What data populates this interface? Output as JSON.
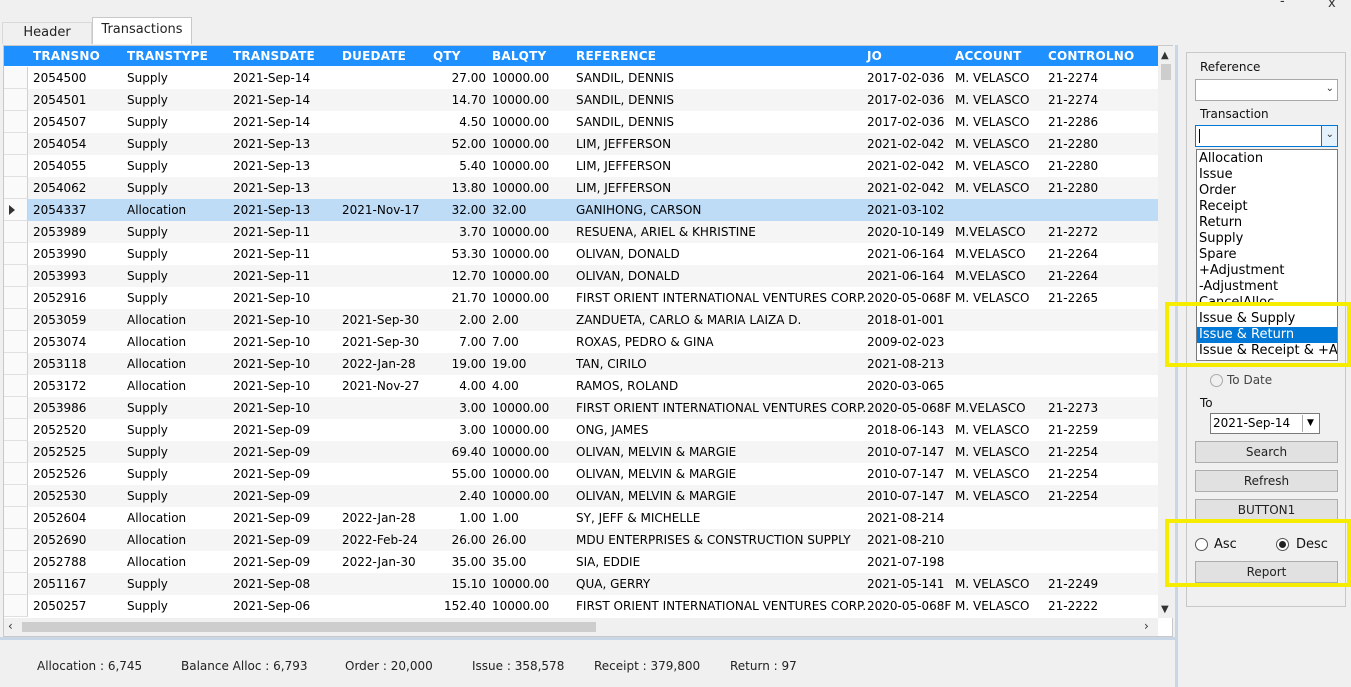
{
  "window": {
    "minimize": "-",
    "close": "x"
  },
  "tabs": [
    {
      "label": "Header"
    },
    {
      "label": "Transactions"
    }
  ],
  "grid": {
    "columns": [
      "TRANSNO",
      "TRANSTYPE",
      "TRANSDATE",
      "DUEDATE",
      "QTY",
      "BALQTY",
      "REFERENCE",
      "JO",
      "ACCOUNT",
      "CONTROLNO"
    ],
    "rows": [
      [
        "2054500",
        "Supply",
        "2021-Sep-14",
        "",
        "27.00",
        "10000.00",
        "SANDIL, DENNIS",
        "2017-02-036",
        "M. VELASCO",
        "21-2274"
      ],
      [
        "2054501",
        "Supply",
        "2021-Sep-14",
        "",
        "14.70",
        "10000.00",
        "SANDIL, DENNIS",
        "2017-02-036",
        "M. VELASCO",
        "21-2274"
      ],
      [
        "2054507",
        "Supply",
        "2021-Sep-14",
        "",
        "4.50",
        "10000.00",
        "SANDIL, DENNIS",
        "2017-02-036",
        "M. VELASCO",
        "21-2286"
      ],
      [
        "2054054",
        "Supply",
        "2021-Sep-13",
        "",
        "52.00",
        "10000.00",
        "LIM, JEFFERSON",
        "2021-02-042",
        "M. VELASCO",
        "21-2280"
      ],
      [
        "2054055",
        "Supply",
        "2021-Sep-13",
        "",
        "5.40",
        "10000.00",
        "LIM, JEFFERSON",
        "2021-02-042",
        "M. VELASCO",
        "21-2280"
      ],
      [
        "2054062",
        "Supply",
        "2021-Sep-13",
        "",
        "13.80",
        "10000.00",
        "LIM, JEFFERSON",
        "2021-02-042",
        "M. VELASCO",
        "21-2280"
      ],
      [
        "2054337",
        "Allocation",
        "2021-Sep-13",
        "2021-Nov-17",
        "32.00",
        "32.00",
        "GANIHONG, CARSON",
        "2021-03-102",
        "",
        ""
      ],
      [
        "2053989",
        "Supply",
        "2021-Sep-11",
        "",
        "3.70",
        "10000.00",
        "RESUENA, ARIEL & KHRISTINE",
        "2020-10-149",
        "M.VELASCO",
        "21-2272"
      ],
      [
        "2053990",
        "Supply",
        "2021-Sep-11",
        "",
        "53.30",
        "10000.00",
        "OLIVAN, DONALD",
        "2021-06-164",
        "M.VELASCO",
        "21-2264"
      ],
      [
        "2053993",
        "Supply",
        "2021-Sep-11",
        "",
        "12.70",
        "10000.00",
        "OLIVAN, DONALD",
        "2021-06-164",
        "M.VELASCO",
        "21-2264"
      ],
      [
        "2052916",
        "Supply",
        "2021-Sep-10",
        "",
        "21.70",
        "10000.00",
        "FIRST ORIENT INTERNATIONAL VENTURES CORP.",
        "2020-05-068F",
        "M. VELASCO",
        "21-2265"
      ],
      [
        "2053059",
        "Allocation",
        "2021-Sep-10",
        "2021-Sep-30",
        "2.00",
        "2.00",
        "ZANDUETA, CARLO & MARIA LAIZA D.",
        "2018-01-001",
        "",
        ""
      ],
      [
        "2053074",
        "Allocation",
        "2021-Sep-10",
        "2021-Sep-30",
        "7.00",
        "7.00",
        "ROXAS, PEDRO & GINA",
        "2009-02-023",
        "",
        ""
      ],
      [
        "2053118",
        "Allocation",
        "2021-Sep-10",
        "2022-Jan-28",
        "19.00",
        "19.00",
        "TAN, CIRILO",
        "2021-08-213",
        "",
        ""
      ],
      [
        "2053172",
        "Allocation",
        "2021-Sep-10",
        "2021-Nov-27",
        "4.00",
        "4.00",
        "RAMOS, ROLAND",
        "2020-03-065",
        "",
        ""
      ],
      [
        "2053986",
        "Supply",
        "2021-Sep-10",
        "",
        "3.00",
        "10000.00",
        "FIRST ORIENT INTERNATIONAL VENTURES CORP.",
        "2020-05-068F",
        "M.VELASCO",
        "21-2273"
      ],
      [
        "2052520",
        "Supply",
        "2021-Sep-09",
        "",
        "3.00",
        "10000.00",
        "ONG, JAMES",
        "2018-06-143",
        "M. VELASCO",
        "21-2259"
      ],
      [
        "2052525",
        "Supply",
        "2021-Sep-09",
        "",
        "69.40",
        "10000.00",
        "OLIVAN, MELVIN & MARGIE",
        "2010-07-147",
        "M. VELASCO",
        "21-2254"
      ],
      [
        "2052526",
        "Supply",
        "2021-Sep-09",
        "",
        "55.00",
        "10000.00",
        "OLIVAN, MELVIN & MARGIE",
        "2010-07-147",
        "M. VELASCO",
        "21-2254"
      ],
      [
        "2052530",
        "Supply",
        "2021-Sep-09",
        "",
        "2.40",
        "10000.00",
        "OLIVAN, MELVIN & MARGIE",
        "2010-07-147",
        "M. VELASCO",
        "21-2254"
      ],
      [
        "2052604",
        "Allocation",
        "2021-Sep-09",
        "2022-Jan-28",
        "1.00",
        "1.00",
        "SY, JEFF & MICHELLE",
        "2021-08-214",
        "",
        ""
      ],
      [
        "2052690",
        "Allocation",
        "2021-Sep-09",
        "2022-Feb-24",
        "26.00",
        "26.00",
        "MDU ENTERPRISES & CONSTRUCTION SUPPLY",
        "2021-08-210",
        "",
        ""
      ],
      [
        "2052788",
        "Allocation",
        "2021-Sep-09",
        "2022-Jan-30",
        "35.00",
        "35.00",
        "SIA, EDDIE",
        "2021-07-198",
        "",
        ""
      ],
      [
        "2051167",
        "Supply",
        "2021-Sep-08",
        "",
        "15.10",
        "10000.00",
        "QUA, GERRY",
        "2021-05-141",
        "M. VELASCO",
        "21-2249"
      ],
      [
        "2050257",
        "Supply",
        "2021-Sep-06",
        "",
        "152.40",
        "10000.00",
        "FIRST ORIENT INTERNATIONAL VENTURES CORP.",
        "2020-05-068F",
        "M. VELASCO",
        "21-2222"
      ]
    ],
    "selected_row_index": 6
  },
  "status": {
    "allocation": "Allocation :  6,745",
    "balance_alloc": "Balance Alloc :  6,793",
    "order": "Order :  20,000",
    "issue": "Issue :  358,578",
    "receipt": "Receipt :  379,800",
    "return": "Return :  97"
  },
  "panel": {
    "reference_label": "Reference",
    "reference_value": "",
    "transaction_label": "Transaction",
    "transaction_value": "",
    "transaction_options": [
      "Allocation",
      "Issue",
      "Order",
      "Receipt",
      "Return",
      "Supply",
      "Spare",
      "+Adjustment",
      "-Adjustment",
      "CancelAlloc",
      "Issue & Supply",
      "Issue & Return",
      "Issue & Receipt & +Adjustment"
    ],
    "highlighted_option": "Issue & Return",
    "to_date_label": "To Date",
    "to_label": "To",
    "to_value": "2021-Sep-14",
    "search_button": "Search",
    "refresh_button": "Refresh",
    "button1": "BUTTON1",
    "asc_label": "Asc",
    "desc_label": "Desc",
    "sort_selected": "Desc",
    "report_button": "Report"
  },
  "highlight_color": "#f5ec00",
  "accent_color": "#1e90ff"
}
